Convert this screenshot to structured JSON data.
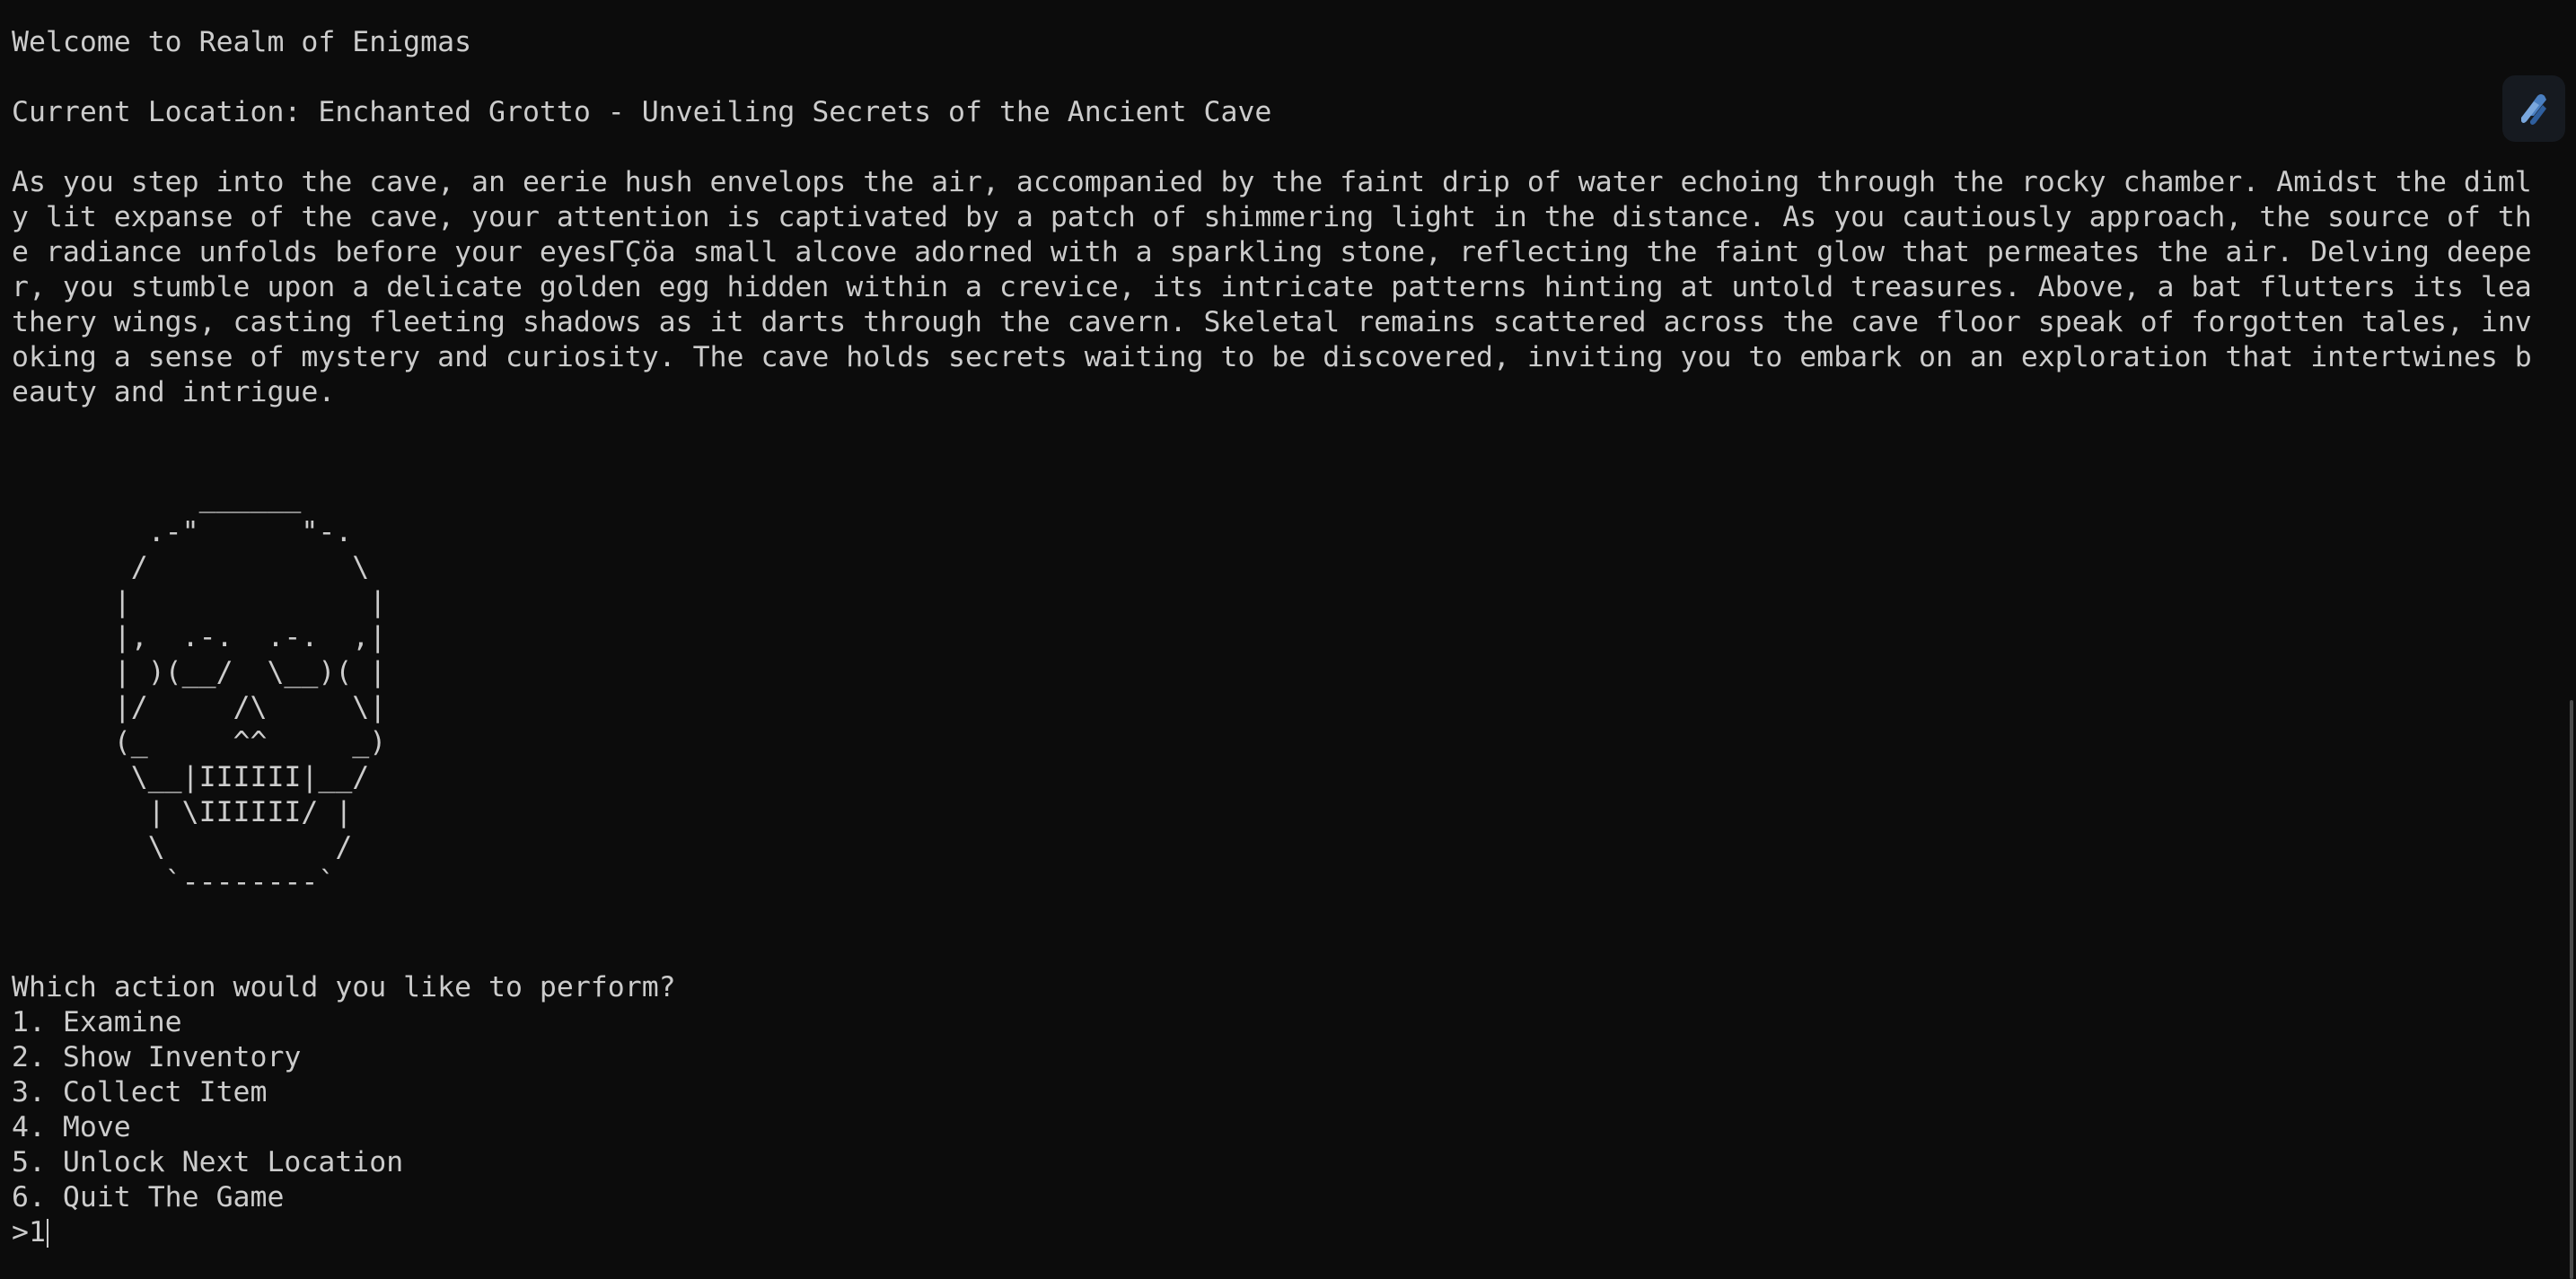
{
  "terminal": {
    "welcome": "Welcome to Realm of Enigmas",
    "location": "Current Location: Enchanted Grotto - Unveiling Secrets of the Ancient Cave",
    "description_lines": [
      "As you step into the cave, an eerie hush envelops the air, accompanied by the faint drip of water echoing through the rocky chamber. Amidst the diml",
      "y lit expanse of the cave, your attention is captivated by a patch of shimmering light in the distance. As you cautiously approach, the source of th",
      "e radiance unfolds before your eyesΓÇöa small alcove adorned with a sparkling stone, reflecting the faint glow that permeates the air. Delving deepe",
      "r, you stumble upon a delicate golden egg hidden within a crevice, its intricate patterns hinting at untold treasures. Above, a bat flutters its lea",
      "thery wings, casting fleeting shadows as it darts through the cavern. Skeletal remains scattered across the cave floor speak of forgotten tales, inv",
      "oking a sense of mystery and curiosity. The cave holds secrets waiting to be discovered, inviting you to embark on an exploration that intertwines b",
      "eauty and intrigue."
    ],
    "ascii_art": "           ______\n        .-\"      \"-.\n       /            \\\n      |              |\n      |,  .-.  .-.  ,|\n      | )(__/  \\__)( |\n      |/     /\\     \\|\n      (_     ^^     _)\n       \\__|IIIIII|__/\n        | \\IIIIII/ |\n        \\          /\n         `--------`",
    "question": "Which action would you like to perform?",
    "options": [
      "1. Examine",
      "2. Show Inventory",
      "3. Collect Item",
      "4. Move",
      "5. Unlock Next Location",
      "6. Quit The Game"
    ],
    "prompt_symbol": ">",
    "input_value": "1"
  },
  "icons": {
    "floating_app": "copilot-icon"
  },
  "colors": {
    "background": "#0c0c0c",
    "foreground": "#cccccc"
  }
}
